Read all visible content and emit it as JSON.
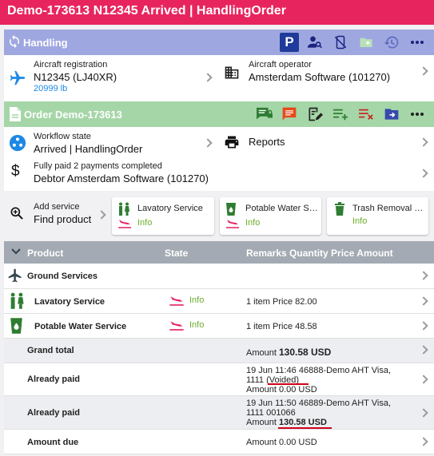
{
  "window": {
    "title": "Demo-173613 N12345 Arrived | HandlingOrder"
  },
  "handling": {
    "label": "Handling",
    "toolbar_icons": [
      "parking-icon",
      "person-search-icon",
      "phone-disabled-icon",
      "folder-add-icon",
      "history-icon",
      "more-icon"
    ]
  },
  "aircraft": {
    "reg_label": "Aircraft registration",
    "reg_value": "N12345 (LJ40XR)",
    "weight": "20999 lb",
    "operator_label": "Aircraft operator",
    "operator_value": "Amsterdam Software (101270)"
  },
  "order": {
    "label": "Order Demo-173613",
    "toolbar_icons": [
      "chat-lock-icon",
      "comment-icon",
      "edit-note-icon",
      "playlist-add-icon",
      "playlist-remove-icon",
      "folder-move-icon",
      "more-icon"
    ]
  },
  "workflow": {
    "label": "Workflow state",
    "value": "Arrived | HandlingOrder",
    "reports": "Reports"
  },
  "payment": {
    "label": "Fully paid 2 payments completed",
    "value": "Debtor Amsterdam Software (101270)"
  },
  "services": {
    "add_label": "Add service",
    "find_label": "Find product",
    "cards": [
      {
        "name": "Lavatory Service",
        "status": "Info"
      },
      {
        "name": "Potable Water Se...",
        "status": "Info"
      },
      {
        "name": "Trash Removal (...",
        "status": "Info"
      }
    ]
  },
  "table": {
    "headers": {
      "product": "Product",
      "state": "State",
      "remarks": "Remarks Quantity Price Amount"
    },
    "group": "Ground Services",
    "items": [
      {
        "name": "Lavatory Service",
        "state": "Info",
        "remarks": "1 item Price 82.00"
      },
      {
        "name": "Potable Water Service",
        "state": "Info",
        "remarks": "1 item Price 48.58"
      }
    ],
    "grand_total": {
      "label": "Grand total",
      "prefix": "Amount ",
      "value": "130.58 USD"
    },
    "paid1": {
      "label": "Already paid",
      "line1": "19 Jun 11:46 46888-Demo AHT Visa,",
      "line2a": "1111 ",
      "line2b": "(Voided)",
      "line3": "Amount 0.00 USD"
    },
    "paid2": {
      "label": "Already paid",
      "line1": "19 Jun 11:50 46889-Demo AHT Visa,",
      "line2": "1111 001066",
      "line3a": "Amount ",
      "line3b": "130.58 USD"
    },
    "amount_due": {
      "label": "Amount due",
      "value": "Amount 0.00 USD"
    }
  },
  "colors": {
    "title_bar": "#e8245e",
    "handling_bar": "#9fa7e0",
    "order_bar": "#a5d6a7",
    "table_header": "#a4aab3",
    "info_green": "#6bae2a",
    "accent_blue": "#1e88e5",
    "annotation_red": "#d0021b"
  }
}
